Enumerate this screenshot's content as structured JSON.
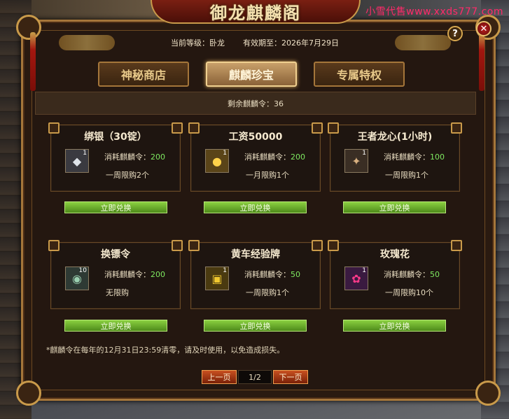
{
  "window": {
    "title": "御龙麒麟阁"
  },
  "watermark": "小雪代售www.xxds777.com",
  "info": {
    "level_text": "当前等级：卧龙",
    "expiry_text": "有效期至：2026年7月29日"
  },
  "tabs": [
    {
      "label": "神秘商店",
      "active": false
    },
    {
      "label": "麒麟珍宝",
      "active": true
    },
    {
      "label": "专属特权",
      "active": false
    }
  ],
  "remaining": "剩余麒麟令：36",
  "items": [
    {
      "name": "绑银（30锭）",
      "qty": "1",
      "icon": "silver-ingot-icon",
      "cost_label": "消耗麒麟令：",
      "cost": "200",
      "limit": "一周限购2个"
    },
    {
      "name": "工资50000",
      "qty": "1",
      "icon": "gold-coins-icon",
      "cost_label": "消耗麒麟令：",
      "cost": "200",
      "limit": "一月限购1个"
    },
    {
      "name": "王者龙心(1小时)",
      "qty": "1",
      "icon": "dragon-heart-icon",
      "cost_label": "消耗麒麟令：",
      "cost": "100",
      "limit": "一周限购1个"
    },
    {
      "name": "换镖令",
      "qty": "10",
      "icon": "escort-token-icon",
      "cost_label": "消耗麒麟令：",
      "cost": "200",
      "limit": "无限购"
    },
    {
      "name": "黄车经验牌",
      "qty": "1",
      "icon": "yellow-cart-icon",
      "cost_label": "消耗麒麟令：",
      "cost": "50",
      "limit": "一周限购1个"
    },
    {
      "name": "玫瑰花",
      "qty": "1",
      "icon": "rose-icon",
      "cost_label": "消耗麒麟令：",
      "cost": "50",
      "limit": "一周限购10个"
    }
  ],
  "buy_label": "立即兑换",
  "note": "*麒麟令在每年的12月31日23:59清零，请及时使用，以免造成损失。",
  "pager": {
    "prev": "上一页",
    "page": "1/2",
    "next": "下一页"
  },
  "help_label": "?",
  "close_label": "✕"
}
